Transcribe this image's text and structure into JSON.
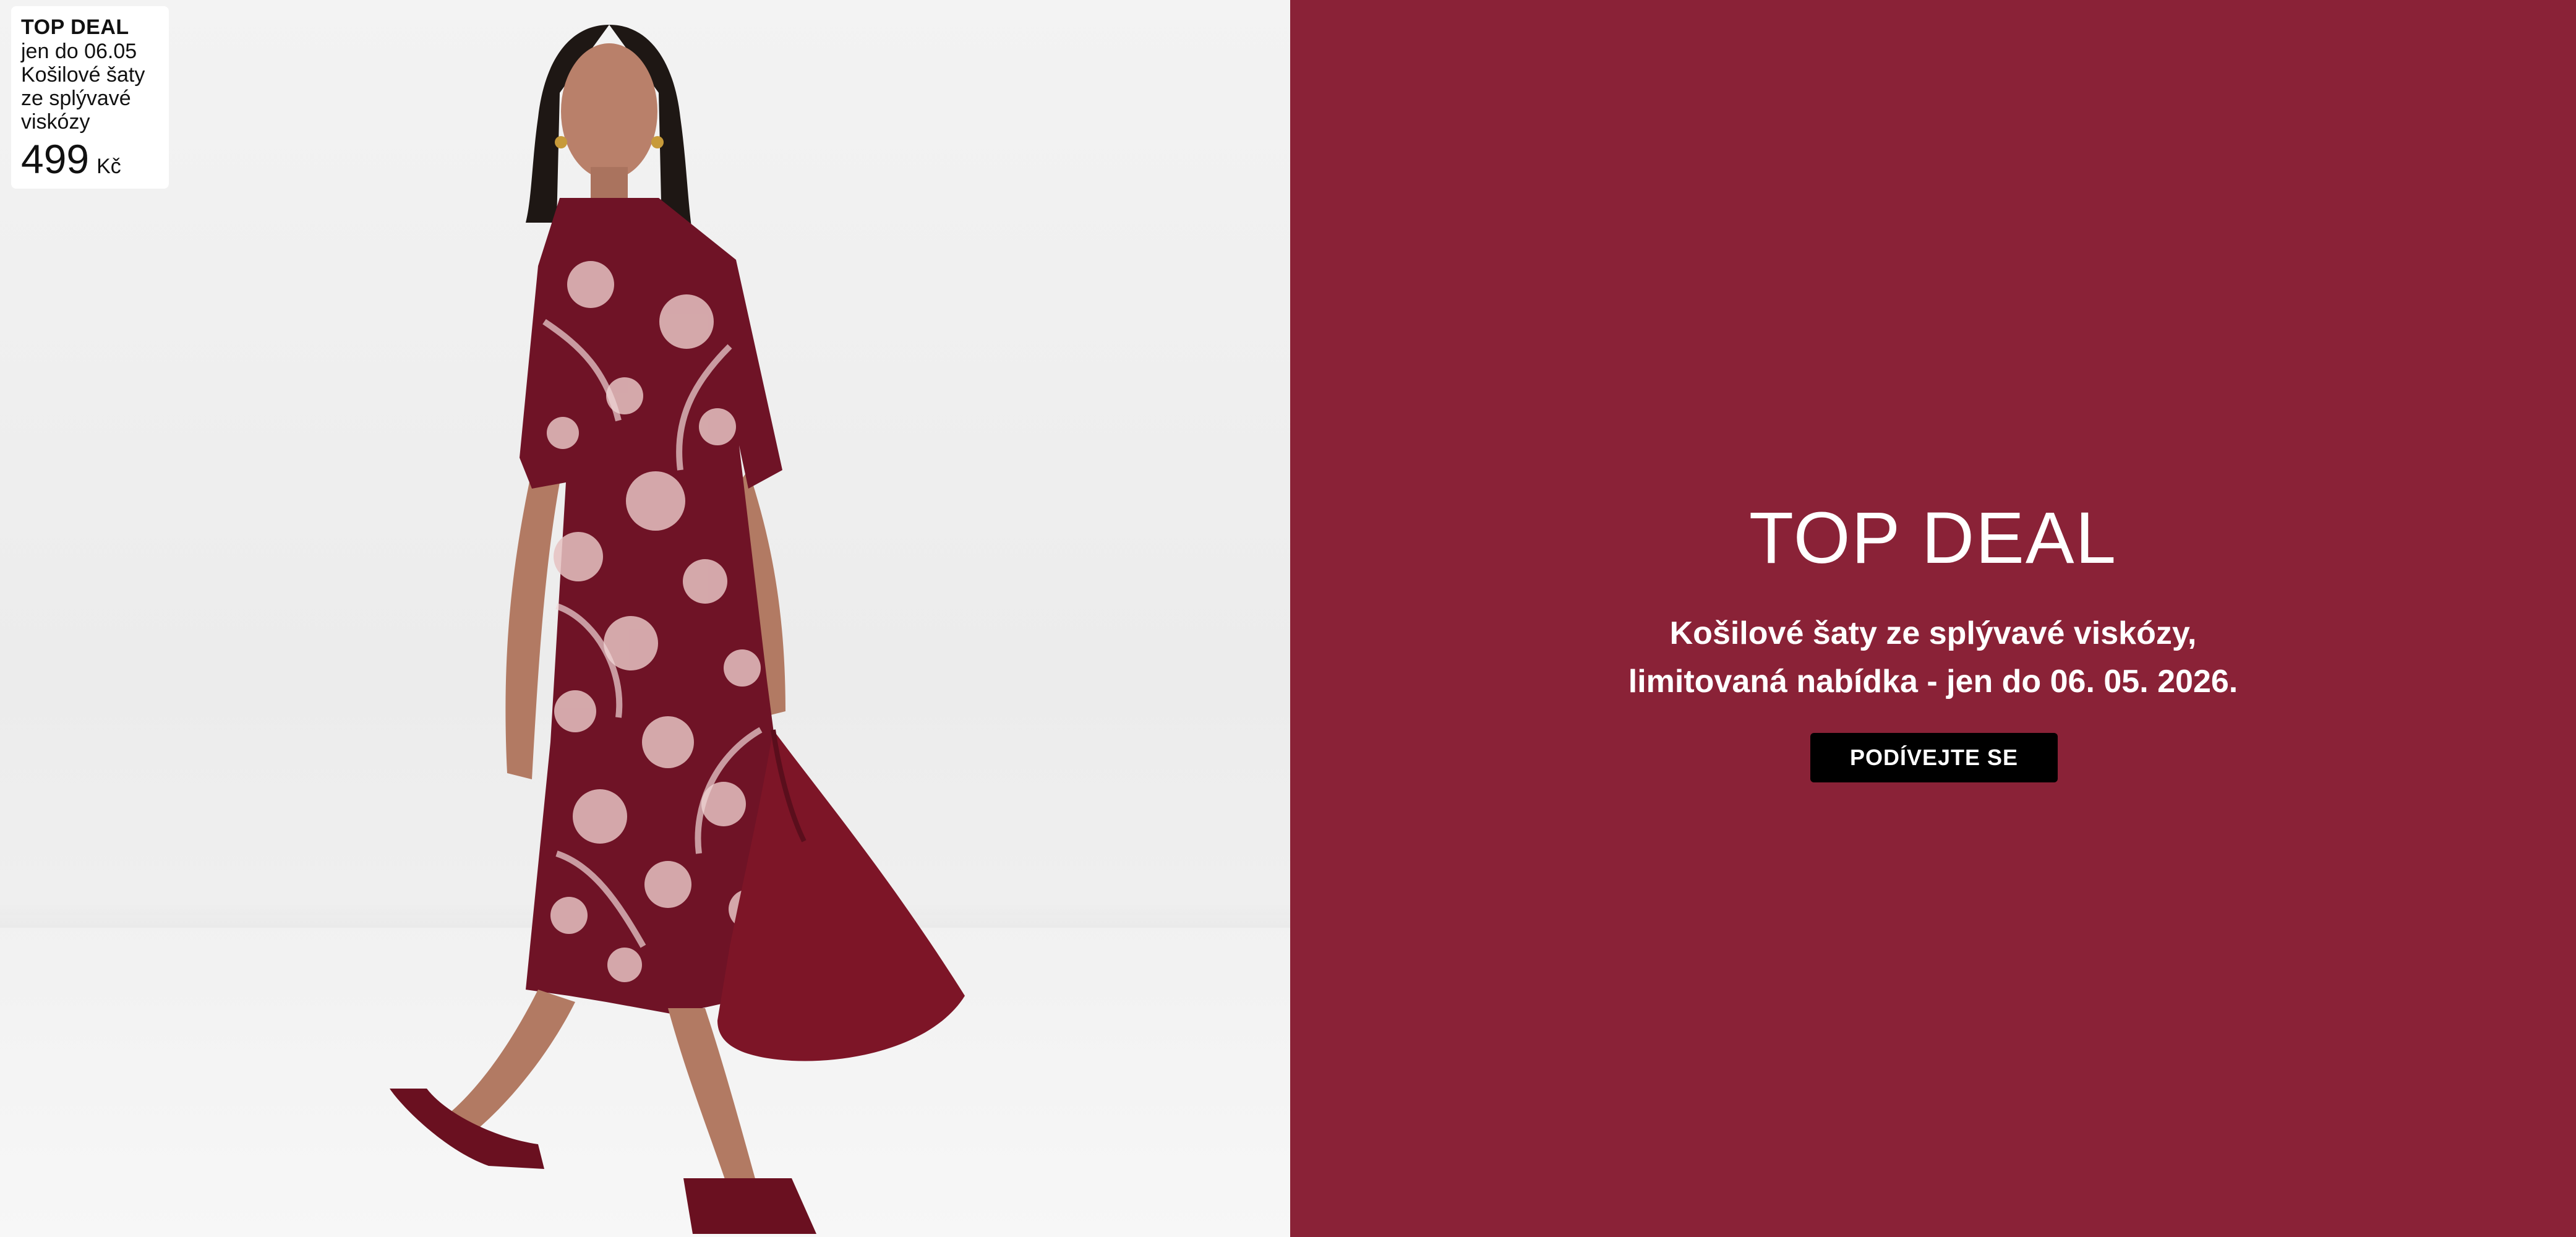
{
  "badge": {
    "title": "TOP DEAL",
    "valid_until": "jen do 06.05",
    "product_line1": "Košilové šaty",
    "product_line2": "ze splývavé",
    "product_line3": "viskózy",
    "price": "499",
    "currency": "Kč"
  },
  "promo": {
    "title": "TOP DEAL",
    "text_line1": "Košilové šaty ze splývavé viskózy,",
    "text_line2": "limitovaná nabídka - jen do 06. 05. 2026.",
    "cta_label": "PODÍVEJTE SE"
  },
  "colors": {
    "promo_background": "#8a2237",
    "cta_background": "#000000",
    "text_on_promo": "#ffffff"
  }
}
